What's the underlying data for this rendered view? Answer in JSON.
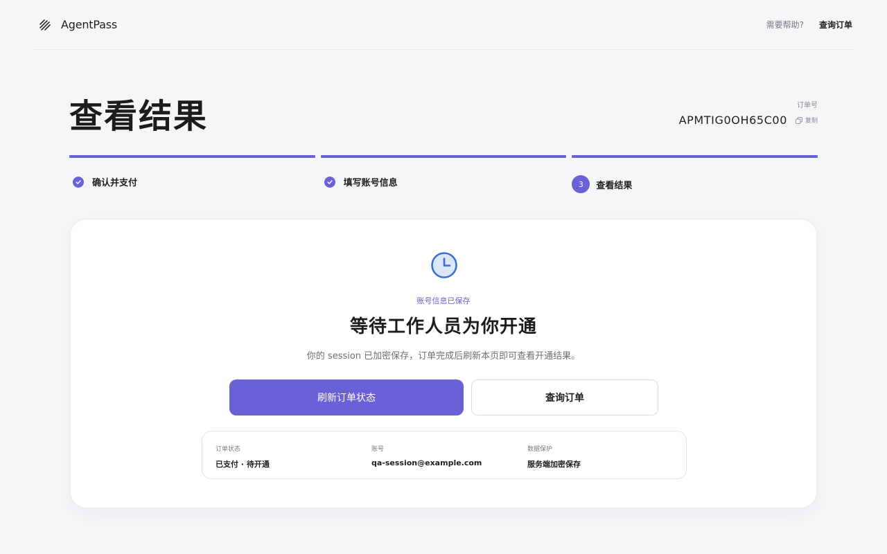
{
  "header": {
    "brand": "AgentPass",
    "help_link": "需要帮助?",
    "query_link": "查询订单"
  },
  "page": {
    "title": "查看结果",
    "order_label": "订单号",
    "order_number": "APMTIG0OH65C00",
    "copy_label": "复制"
  },
  "steps": [
    {
      "label": "确认并支付",
      "state": "done"
    },
    {
      "label": "填写账号信息",
      "state": "done"
    },
    {
      "label": "查看结果",
      "number": "3",
      "state": "current"
    }
  ],
  "result": {
    "status_badge": "账号信息已保存",
    "heading": "等待工作人员为你开通",
    "description": "你的 session 已加密保存，订单完成后刷新本页即可查看开通结果。",
    "refresh_button": "刷新订单状态",
    "query_button": "查询订单",
    "info": [
      {
        "label": "订单状态",
        "value": "已支付 · 待开通"
      },
      {
        "label": "账号",
        "value": "qa-session@example.com"
      },
      {
        "label": "数据保护",
        "value": "服务端加密保存"
      }
    ]
  },
  "colors": {
    "accent": "#6b61d6",
    "clock_stroke": "#3a6fd0",
    "clock_fill": "#dbe6fb",
    "background": "#f5f6f8"
  },
  "icons": {
    "brand": "stripes-logo-icon",
    "copy": "copy-icon",
    "step_done": "check-icon",
    "status": "clock-icon"
  }
}
